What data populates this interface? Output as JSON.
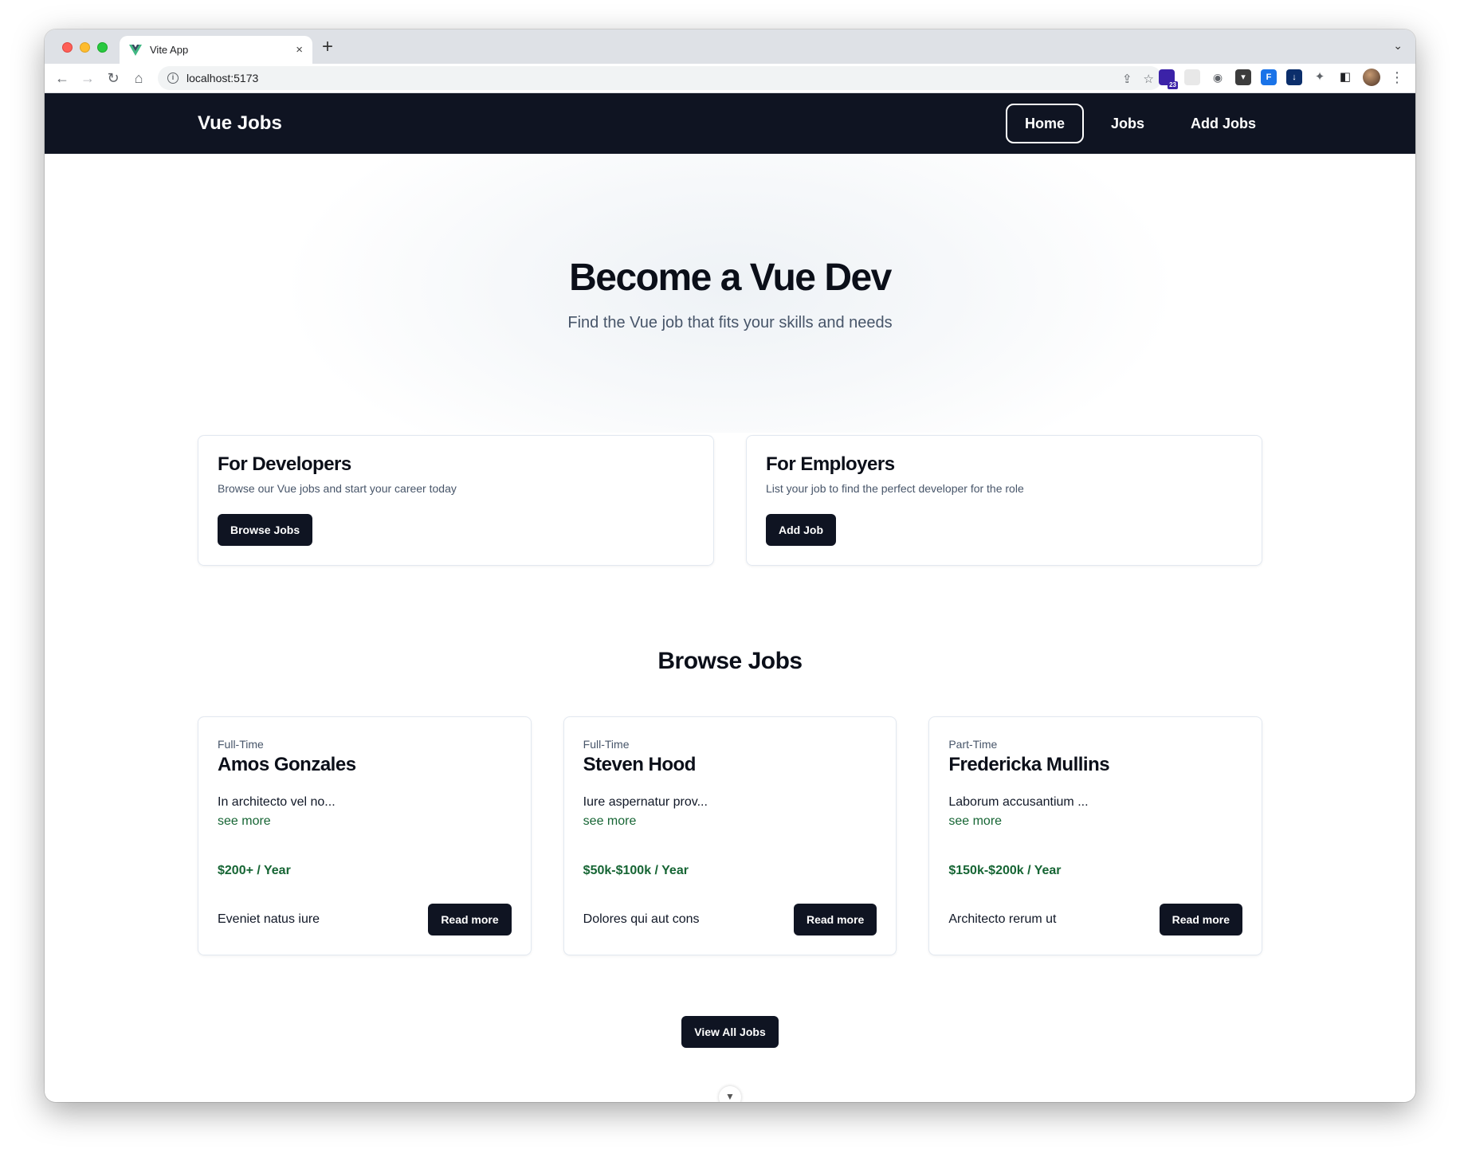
{
  "browser": {
    "tab_title": "Vite App",
    "tab_close": "×",
    "new_tab": "+",
    "tab_menu": "⌄",
    "url": "localhost:5173",
    "extension_badge": "23"
  },
  "navbar": {
    "brand": "Vue Jobs",
    "links": [
      {
        "label": "Home",
        "active": true
      },
      {
        "label": "Jobs",
        "active": false
      },
      {
        "label": "Add Jobs",
        "active": false
      }
    ]
  },
  "hero": {
    "title": "Become a Vue Dev",
    "subtitle": "Find the Vue job that fits your skills and needs"
  },
  "info_cards": [
    {
      "title": "For Developers",
      "text": "Browse our Vue jobs and start your career today",
      "button": "Browse Jobs"
    },
    {
      "title": "For Employers",
      "text": "List your job to find the perfect developer for the role",
      "button": "Add Job"
    }
  ],
  "browse_section": {
    "title": "Browse Jobs",
    "view_all": "View All Jobs"
  },
  "jobs": [
    {
      "type": "Full-Time",
      "title": "Amos Gonzales",
      "description": "In architecto vel no...",
      "see_more": "see more",
      "salary": "$200+ / Year",
      "location": "Eveniet natus iure",
      "button": "Read more"
    },
    {
      "type": "Full-Time",
      "title": "Steven Hood",
      "description": "Iure aspernatur prov...",
      "see_more": "see more",
      "salary": "$50k-$100k / Year",
      "location": "Dolores qui aut cons",
      "button": "Read more"
    },
    {
      "type": "Part-Time",
      "title": "Fredericka Mullins",
      "description": "Laborum accusantium ...",
      "see_more": "see more",
      "salary": "$150k-$200k / Year",
      "location": "Architecto rerum ut",
      "button": "Read more"
    }
  ],
  "colors": {
    "navbar_bg": "#0f1422",
    "accent_green": "#166534",
    "button_dark": "#0f1422"
  }
}
